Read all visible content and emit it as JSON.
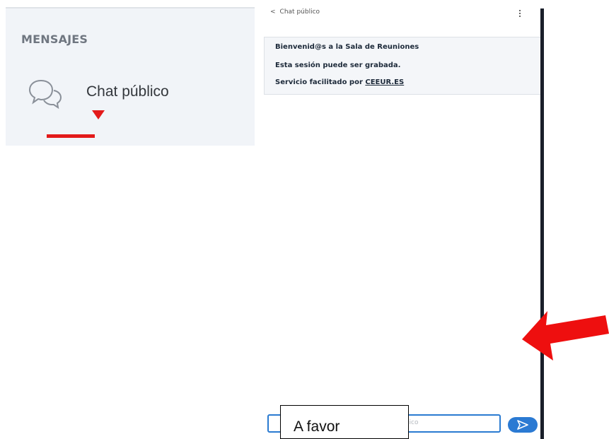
{
  "sidebar": {
    "section_title": "MENSAJES",
    "chat_item": {
      "label": "Chat público",
      "icon": "chat-bubbles-icon"
    }
  },
  "chat": {
    "header": {
      "back_label": "Chat público",
      "back_icon": "chevron-left-icon",
      "menu_icon": "kebab-menu-icon"
    },
    "welcome": {
      "line1": "Bienvenid@s a la Sala de Reuniones",
      "line2": "Esta sesión puede ser grabada.",
      "line3_prefix": "Servicio facilitado por ",
      "line3_link": "CEEUR.ES"
    },
    "input": {
      "placeholder_visible": "lico"
    },
    "send_icon": "send-arrow-icon"
  },
  "annotations": {
    "overlay_label": "A favor",
    "marker_color": "#e31a1a",
    "arrow_icon": "red-arrow-icon"
  },
  "colors": {
    "accent": "#2b7ad3",
    "panel": "#f1f4f8",
    "dark_border": "#1a1f2a"
  }
}
